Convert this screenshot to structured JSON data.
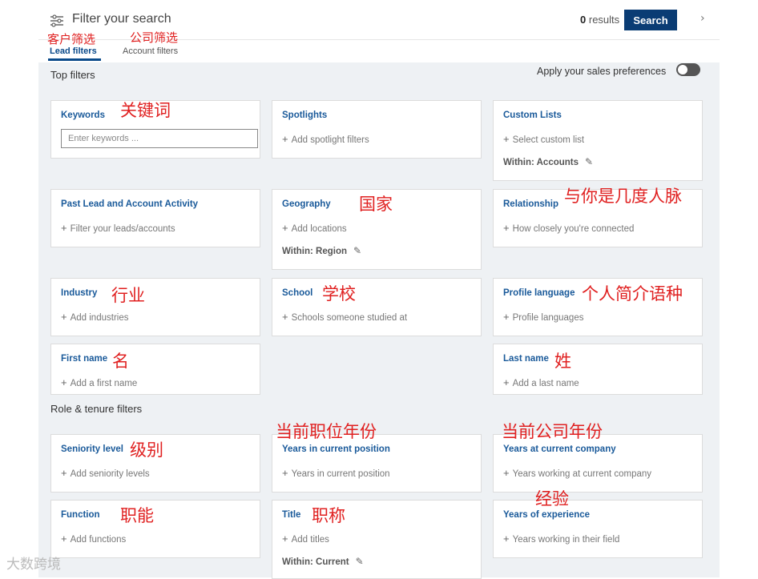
{
  "header": {
    "title": "Filter your search",
    "results_count": "0",
    "results_label": "results",
    "search_button": "Search",
    "more_icon": "chevron-right-icon"
  },
  "tabs": [
    {
      "label": "Lead filters",
      "annotation": "客户筛选",
      "active": true
    },
    {
      "label": "Account filters",
      "annotation": "公司筛选",
      "active": false
    }
  ],
  "top_filters": {
    "title": "Top filters",
    "preference_label": "Apply your sales preferences",
    "preference_on": false
  },
  "cards": {
    "keywords": {
      "title": "Keywords",
      "placeholder": "Enter keywords ...",
      "annotation": "关键词"
    },
    "spotlights": {
      "title": "Spotlights",
      "add": "Add spotlight filters"
    },
    "custom_lists": {
      "title": "Custom Lists",
      "add": "Select custom list",
      "within": "Within: Accounts"
    },
    "past_activity": {
      "title": "Past Lead and Account Activity",
      "add": "Filter your leads/accounts"
    },
    "geography": {
      "title": "Geography",
      "add": "Add locations",
      "within": "Within: Region",
      "annotation": "国家"
    },
    "relationship": {
      "title": "Relationship",
      "add": "How closely you're connected",
      "annotation": "与你是几度人脉"
    },
    "industry": {
      "title": "Industry",
      "add": "Add industries",
      "annotation": "行业"
    },
    "school": {
      "title": "School",
      "add": "Schools someone studied at",
      "annotation": "学校"
    },
    "profile_language": {
      "title": "Profile language",
      "add": "Profile languages",
      "annotation": "个人简介语种"
    },
    "first_name": {
      "title": "First name",
      "add": "Add a first name",
      "annotation": "名"
    },
    "last_name": {
      "title": "Last name",
      "add": "Add a last name",
      "annotation": "姓"
    },
    "seniority": {
      "title": "Seniority level",
      "add": "Add seniority levels",
      "annotation": "级别"
    },
    "years_position": {
      "title": "Years in current position",
      "add": "Years in current position",
      "annotation": "当前职位年份"
    },
    "years_company": {
      "title": "Years at current company",
      "add": "Years working at current company",
      "annotation": "当前公司年份"
    },
    "function": {
      "title": "Function",
      "add": "Add functions",
      "annotation": "职能"
    },
    "title": {
      "title": "Title",
      "add": "Add titles",
      "within": "Within: Current",
      "annotation": "职称"
    },
    "years_experience": {
      "title": "Years of experience",
      "add": "Years working in their field",
      "annotation": "经验"
    }
  },
  "role_tenure": {
    "title": "Role & tenure filters"
  },
  "watermark": "大数跨境",
  "colors": {
    "accent": "#0a3c74",
    "link": "#1a5a9a",
    "annotation": "#e02020",
    "background": "#eef1f4"
  }
}
